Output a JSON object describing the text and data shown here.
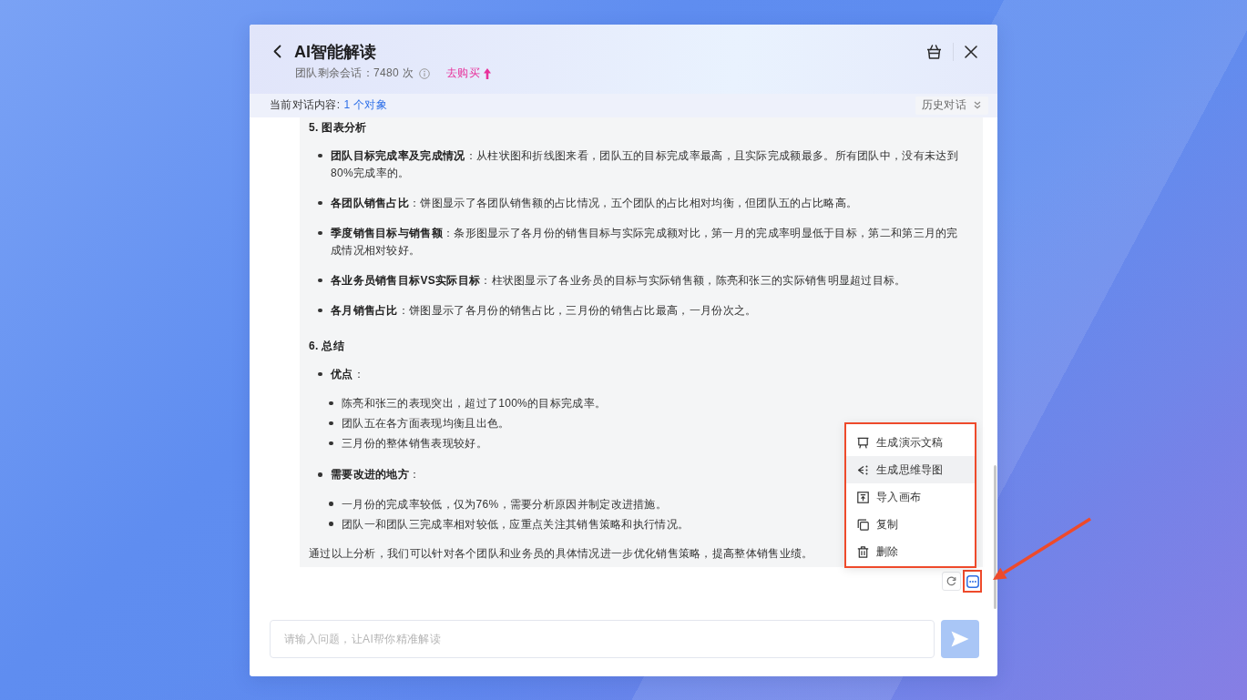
{
  "header": {
    "title": "AI智能解读",
    "quota": "团队剩余会话：7480 次",
    "buy_link": "去购买"
  },
  "context_bar": {
    "label": "当前对话内容:",
    "object_link": "1 个对象",
    "history_button": "历史对话"
  },
  "message": {
    "sections": [
      {
        "heading": "5. 图表分析",
        "items": [
          {
            "text": "**团队目标完成率及完成情况**：从柱状图和折线图来看，团队五的目标完成率最高，且实际完成额最多。所有团队中，没有未达到80%完成率的。"
          },
          {
            "text": "**各团队销售占比**：饼图显示了各团队销售额的占比情况，五个团队的占比相对均衡，但团队五的占比略高。"
          },
          {
            "text": "**季度销售目标与销售额**：条形图显示了各月份的销售目标与实际完成额对比，第一月的完成率明显低于目标，第二和第三月的完成情况相对较好。"
          },
          {
            "text": "**各业务员销售目标VS实际目标**：柱状图显示了各业务员的目标与实际销售额，陈亮和张三的实际销售明显超过目标。"
          },
          {
            "text": "**各月销售占比**：饼图显示了各月份的销售占比，三月份的销售占比最高，一月份次之。"
          }
        ]
      },
      {
        "heading": "6. 总结",
        "items": [
          {
            "text": "**优点**：",
            "children": [
              {
                "text": "陈亮和张三的表现突出，超过了100%的目标完成率。"
              },
              {
                "text": "团队五在各方面表现均衡且出色。"
              },
              {
                "text": "三月份的整体销售表现较好。"
              }
            ]
          },
          {
            "text": "**需要改进的地方**：",
            "children": [
              {
                "text": "一月份的完成率较低，仅为76%，需要分析原因并制定改进措施。"
              },
              {
                "text": "团队一和团队三完成率相对较低，应重点关注其销售策略和执行情况。"
              }
            ]
          }
        ]
      }
    ],
    "conclusion": "通过以上分析，我们可以针对各个团队和业务员的具体情况进一步优化销售策略，提高整体销售业绩。"
  },
  "more_button": {
    "open": true,
    "highlighted": true
  },
  "more_menu": {
    "highlighted": true,
    "items": [
      {
        "label": "生成演示文稿",
        "selected": false
      },
      {
        "label": "生成思维导图",
        "selected": true
      },
      {
        "label": "导入画布",
        "selected": false
      },
      {
        "label": "复制",
        "selected": false
      },
      {
        "label": "删除",
        "selected": false
      }
    ]
  },
  "annotation_arrow": true,
  "input": {
    "placeholder": "请输入问题，让AI帮你精准解读"
  },
  "send_button": {
    "disabled": true
  }
}
